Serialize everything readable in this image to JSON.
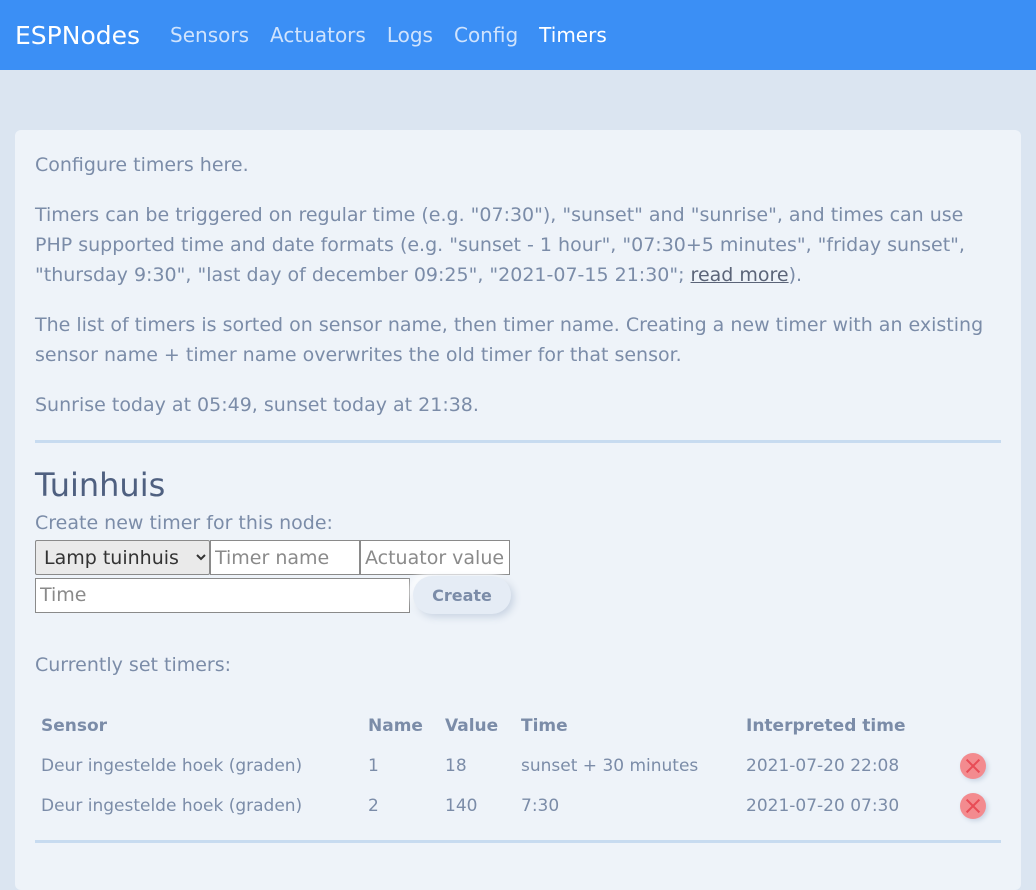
{
  "nav": {
    "brand": "ESPNodes",
    "links": [
      {
        "label": "Sensors"
      },
      {
        "label": "Actuators"
      },
      {
        "label": "Logs"
      },
      {
        "label": "Config"
      },
      {
        "label": "Timers"
      }
    ],
    "active": "Timers"
  },
  "intro": {
    "line1": "Configure timers here.",
    "line2": "Timers can be triggered on regular time (e.g. \"07:30\"), \"sunset\" and \"sunrise\", and times can use PHP supported time and date formats (e.g. \"sunset - 1 hour\", \"07:30+5 minutes\", \"friday sunset\", \"thursday 9:30\", \"last day of december 09:25\", \"2021-07-15 21:30\"; ",
    "read_more": "read more",
    "line2_end": ").",
    "line3": "The list of timers is sorted on sensor name, then timer name. Creating a new timer with an existing sensor name + timer name overwrites the old timer for that sensor.",
    "line4": "Sunrise today at 05:49, sunset today at 21:38."
  },
  "node": {
    "title": "Tuinhuis",
    "create_label": "Create new timer for this node:",
    "selected_sensor": "Lamp tuinhuis",
    "timer_name_placeholder": "Timer name",
    "actuator_value_placeholder": "Actuator value",
    "time_placeholder": "Time",
    "create_button": "Create",
    "current_label": "Currently set timers:",
    "table": {
      "headers": [
        "Sensor",
        "Name",
        "Value",
        "Time",
        "Interpreted time"
      ],
      "rows": [
        {
          "sensor": "Deur ingestelde hoek (graden)",
          "name": "1",
          "value": "18",
          "time": "sunset + 30 minutes",
          "interpreted": "2021-07-20 22:08"
        },
        {
          "sensor": "Deur ingestelde hoek (graden)",
          "name": "2",
          "value": "140",
          "time": "7:30",
          "interpreted": "2021-07-20 07:30"
        }
      ]
    }
  },
  "colors": {
    "navbar": "#3b8ff5",
    "background": "#dbe5f1",
    "card": "#eef3f9",
    "text": "#7b8ca8",
    "delete": "#f38b8f"
  },
  "icons": {
    "delete": "close-icon"
  }
}
